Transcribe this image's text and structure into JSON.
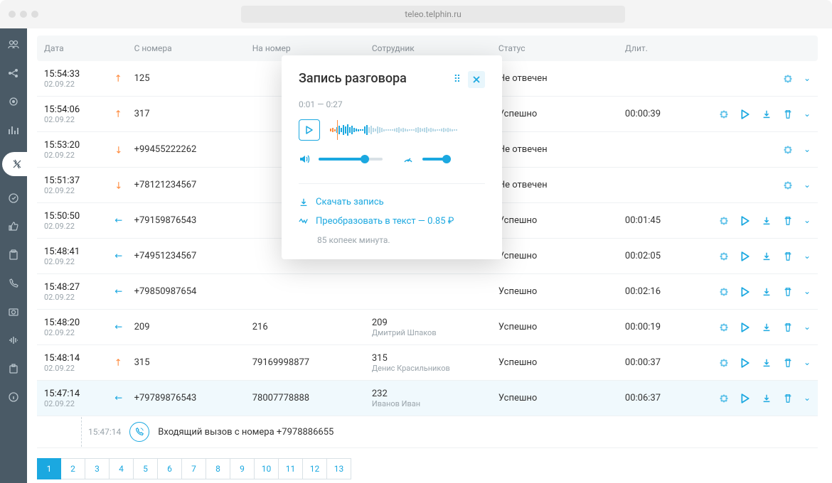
{
  "browser": {
    "url": "teleo.telphin.ru"
  },
  "table": {
    "headers": {
      "date": "Дата",
      "from": "С номера",
      "to": "На номер",
      "employee": "Сотрудник",
      "status": "Статус",
      "duration": "Длит."
    },
    "rows": [
      {
        "time": "15:54:33",
        "date": "02.09.22",
        "dir": "out",
        "from": "125",
        "to": "",
        "emp_num": "",
        "emp_name": "",
        "status": "Не отвечен",
        "duration": "",
        "actions": [
          "dots"
        ]
      },
      {
        "time": "15:54:06",
        "date": "02.09.22",
        "dir": "out",
        "from": "317",
        "to": "",
        "emp_num": "",
        "emp_name": "",
        "status": "Успешно",
        "duration": "00:00:39",
        "actions": [
          "dots",
          "play",
          "download",
          "delete"
        ]
      },
      {
        "time": "15:53:20",
        "date": "02.09.22",
        "dir": "miss",
        "from": "+99455222262",
        "to": "",
        "emp_num": "",
        "emp_name": "",
        "status": "Не отвечен",
        "duration": "",
        "actions": [
          "dots"
        ]
      },
      {
        "time": "15:51:37",
        "date": "02.09.22",
        "dir": "miss",
        "from": "+78121234567",
        "to": "",
        "emp_num": "",
        "emp_name": "",
        "status": "Не отвечен",
        "duration": "",
        "actions": [
          "dots"
        ]
      },
      {
        "time": "15:50:50",
        "date": "02.09.22",
        "dir": "in",
        "from": "+79159876543",
        "to": "",
        "emp_num": "",
        "emp_name": "",
        "status": "Успешно",
        "duration": "00:01:45",
        "actions": [
          "dots",
          "play",
          "download",
          "delete"
        ]
      },
      {
        "time": "15:48:41",
        "date": "02.09.22",
        "dir": "in",
        "from": "+74951234567",
        "to": "",
        "emp_num": "",
        "emp_name": "",
        "status": "Успешно",
        "duration": "00:02:05",
        "actions": [
          "dots",
          "play",
          "download",
          "delete"
        ]
      },
      {
        "time": "15:48:27",
        "date": "02.09.22",
        "dir": "in",
        "from": "+79850987654",
        "to": "",
        "emp_num": "",
        "emp_name": "",
        "status": "Успешно",
        "duration": "00:02:16",
        "actions": [
          "dots",
          "play",
          "download",
          "delete"
        ]
      },
      {
        "time": "15:48:20",
        "date": "02.09.22",
        "dir": "in",
        "from": "209",
        "to": "216",
        "emp_num": "209",
        "emp_name": "Дмитрий Шпаков",
        "status": "Успешно",
        "duration": "00:00:19",
        "actions": [
          "dots",
          "play",
          "download",
          "delete"
        ]
      },
      {
        "time": "15:48:14",
        "date": "02.09.22",
        "dir": "out",
        "from": "315",
        "to": "79169998877",
        "emp_num": "315",
        "emp_name": "Денис Красильников",
        "status": "Успешно",
        "duration": "00:00:37",
        "actions": [
          "dots",
          "play",
          "download",
          "delete"
        ]
      },
      {
        "time": "15:47:14",
        "date": "02.09.22",
        "dir": "in",
        "from": "+79789876543",
        "to": "78007778888",
        "emp_num": "232",
        "emp_name": "Иванов Иван",
        "status": "Успешно",
        "duration": "00:06:37",
        "actions": [
          "dots",
          "play",
          "download",
          "delete"
        ],
        "expanded": true
      }
    ],
    "expanded_detail": {
      "time": "15:47:14",
      "text": "Входящий вызов с номера +7978886655"
    }
  },
  "pagination": [
    "1",
    "2",
    "3",
    "4",
    "5",
    "6",
    "7",
    "8",
    "9",
    "10",
    "11",
    "12",
    "13"
  ],
  "popup": {
    "title": "Запись разговора",
    "time_current": "0:01",
    "time_sep": " — ",
    "time_total": "0:27",
    "download_label": "Скачать запись",
    "transcribe_label": "Преобразовать в текст — 0.85 ₽",
    "note": "85 копеек минута."
  },
  "hidden_fragments": {
    "row2_end": "е",
    "row3_end": "39"
  }
}
